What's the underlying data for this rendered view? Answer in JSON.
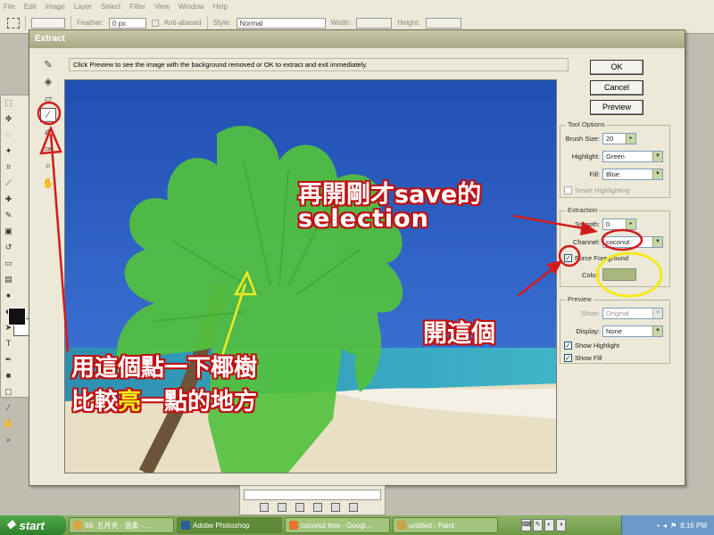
{
  "menubar": {
    "items": [
      "File",
      "Edit",
      "Image",
      "Layer",
      "Select",
      "Filter",
      "View",
      "Window",
      "Help"
    ]
  },
  "options_bar": {
    "feather_label": "Feather:",
    "feather_value": "0 px",
    "anti_aliased_label": "Anti-aliased",
    "style_label": "Style:",
    "style_value": "Normal",
    "width_label": "Width:",
    "height_label": "Height:"
  },
  "dialog": {
    "title": "Extract",
    "hint": "Click Preview to see the image with the background removed or OK to extract and exit immediately.",
    "buttons": {
      "ok": "OK",
      "cancel": "Cancel",
      "preview": "Preview"
    },
    "tool_options": {
      "title": "Tool Options",
      "brush_size_label": "Brush Size:",
      "brush_size_value": "20",
      "highlight_label": "Highlight:",
      "highlight_value": "Green",
      "fill_label": "Fill:",
      "fill_value": "Blue",
      "smart_highlighting_label": "Smart Highlighting"
    },
    "extraction": {
      "title": "Extraction",
      "smooth_label": "Smooth:",
      "smooth_value": "0",
      "channel_label": "Channel:",
      "channel_value": "coconut",
      "force_foreground_label": "Force Foreground",
      "color_label": "Color:",
      "swatch_color": "#a9b87a"
    },
    "preview_group": {
      "title": "Preview",
      "show_label": "Show:",
      "show_value": "Original",
      "display_label": "Display:",
      "display_value": "None",
      "show_highlight_label": "Show Highlight",
      "show_fill_label": "Show Fill"
    }
  },
  "annotations": {
    "reopen_line1": "再開剛才save的",
    "reopen_line2": "selection",
    "open_this": "開這個",
    "use_line1": "用這個點一下椰樹",
    "use_line2_a": "比較",
    "use_line2_b": "亮",
    "use_line2_c": "一點的地方"
  },
  "taskbar": {
    "start_label": "start",
    "tasks": [
      {
        "label": "59. 五月天 - 溫柔 - ...",
        "icon_color": "#d9a441"
      },
      {
        "label": "Adobe Photoshop",
        "icon_color": "#2a5f9e"
      },
      {
        "label": "coconut tree - Googl...",
        "icon_color": "#e8732a"
      },
      {
        "label": "untitled - Paint",
        "icon_color": "#c9a34a"
      }
    ],
    "clock": "8:16 PM"
  },
  "colors": {
    "annotation_outline": "#c01010",
    "annotation_highlight": "#f6ee1a",
    "arrow_red": "#d21c1c",
    "arrow_yellow": "#f1ea22",
    "circle_yellow": "#f3ea1a",
    "highlight_green": "#4fc63a"
  }
}
